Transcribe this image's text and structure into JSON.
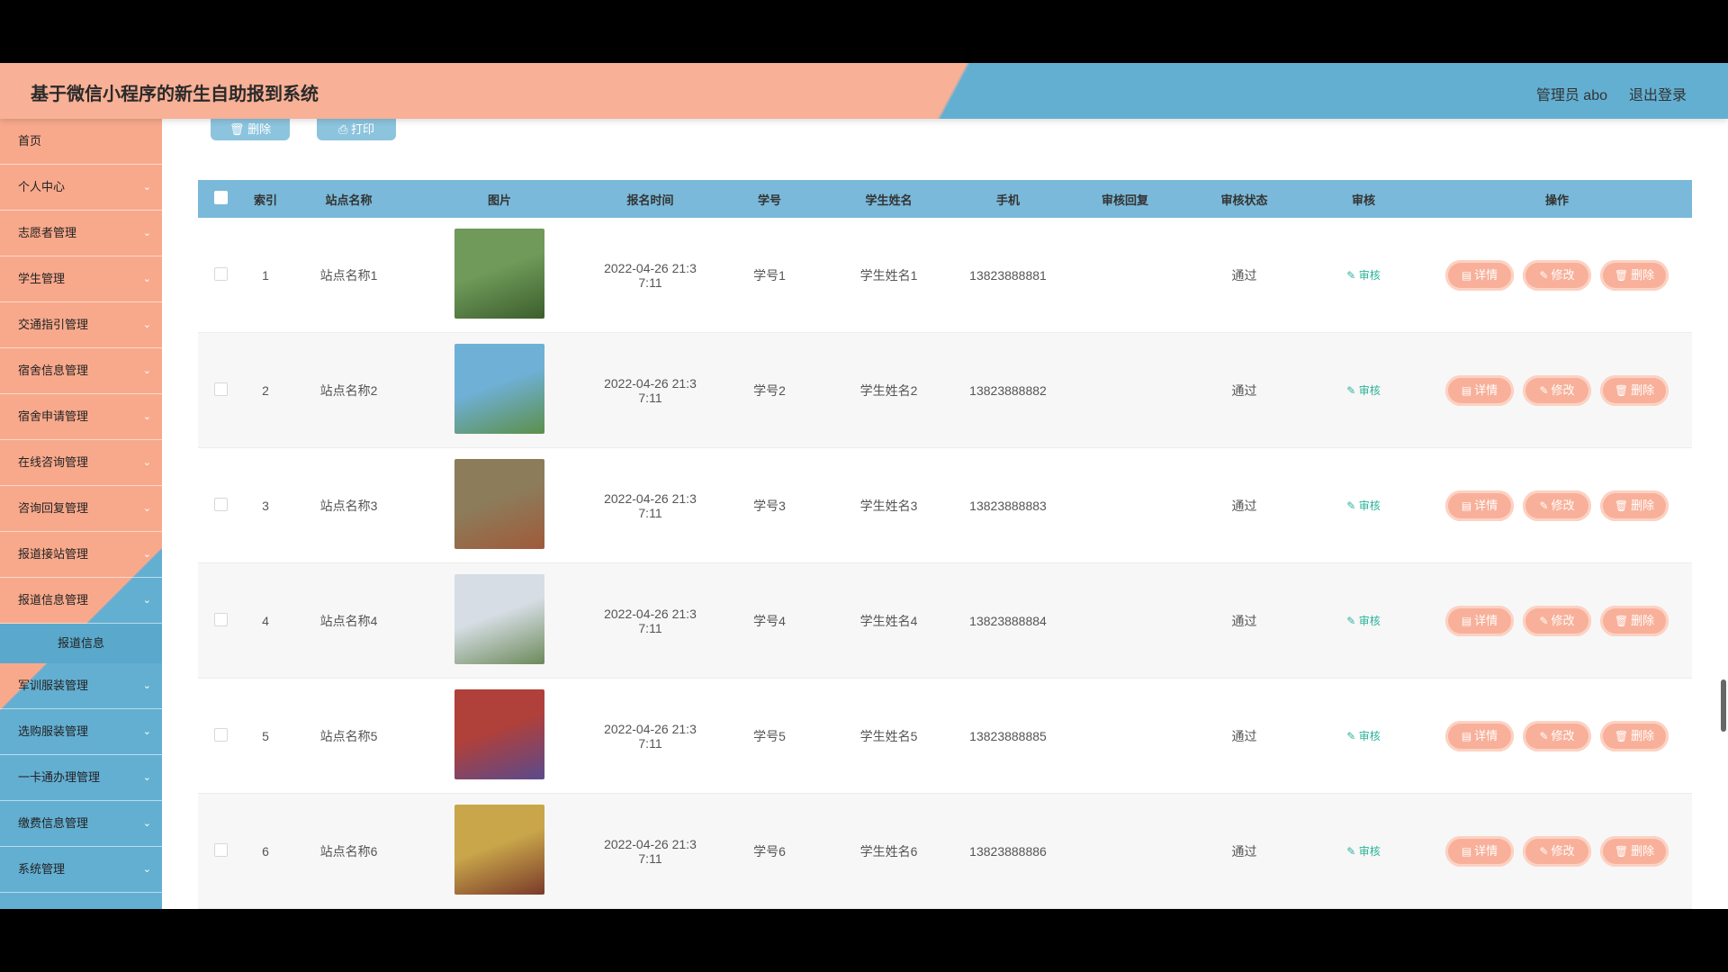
{
  "app": {
    "title": "基于微信小程序的新生自助报到系统"
  },
  "header": {
    "admin_label": "管理员 abo",
    "logout_label": "退出登录"
  },
  "sidebar": {
    "items": [
      {
        "label": "首页",
        "chevron": false
      },
      {
        "label": "个人中心",
        "chevron": true
      },
      {
        "label": "志愿者管理",
        "chevron": true
      },
      {
        "label": "学生管理",
        "chevron": true
      },
      {
        "label": "交通指引管理",
        "chevron": true
      },
      {
        "label": "宿舍信息管理",
        "chevron": true
      },
      {
        "label": "宿舍申请管理",
        "chevron": true
      },
      {
        "label": "在线咨询管理",
        "chevron": true
      },
      {
        "label": "咨询回复管理",
        "chevron": true
      },
      {
        "label": "报道接站管理",
        "chevron": true
      },
      {
        "label": "报道信息管理",
        "chevron": true
      }
    ],
    "active_sub": "报道信息",
    "items_after": [
      {
        "label": "军训服装管理",
        "chevron": true
      },
      {
        "label": "选购服装管理",
        "chevron": true
      },
      {
        "label": "一卡通办理管理",
        "chevron": true
      },
      {
        "label": "缴费信息管理",
        "chevron": true
      },
      {
        "label": "系统管理",
        "chevron": true
      }
    ]
  },
  "toolbar": {
    "delete_label": "删除",
    "print_label": "打印"
  },
  "table": {
    "headers": [
      "索引",
      "站点名称",
      "图片",
      "报名时间",
      "学号",
      "学生姓名",
      "手机",
      "审核回复",
      "审核状态",
      "审核",
      "操作"
    ],
    "rows": [
      {
        "index": "1",
        "site": "站点名称1",
        "time_line1": "2022-04-26 21:3",
        "time_line2": "7:11",
        "sno": "学号1",
        "name": "学生姓名1",
        "phone": "13823888881",
        "reply": "",
        "status": "通过",
        "image_colors": [
          "#6f9a5a",
          "#3c5e2c"
        ]
      },
      {
        "index": "2",
        "site": "站点名称2",
        "time_line1": "2022-04-26 21:3",
        "time_line2": "7:11",
        "sno": "学号2",
        "name": "学生姓名2",
        "phone": "13823888882",
        "reply": "",
        "status": "通过",
        "image_colors": [
          "#6fb0d6",
          "#5c8f4a"
        ]
      },
      {
        "index": "3",
        "site": "站点名称3",
        "time_line1": "2022-04-26 21:3",
        "time_line2": "7:11",
        "sno": "学号3",
        "name": "学生姓名3",
        "phone": "13823888883",
        "reply": "",
        "status": "通过",
        "image_colors": [
          "#8c7c5a",
          "#a05a3a"
        ]
      },
      {
        "index": "4",
        "site": "站点名称4",
        "time_line1": "2022-04-26 21:3",
        "time_line2": "7:11",
        "sno": "学号4",
        "name": "学生姓名4",
        "phone": "13823888884",
        "reply": "",
        "status": "通过",
        "image_colors": [
          "#d6dde4",
          "#6c8a5a"
        ]
      },
      {
        "index": "5",
        "site": "站点名称5",
        "time_line1": "2022-04-26 21:3",
        "time_line2": "7:11",
        "sno": "学号5",
        "name": "学生姓名5",
        "phone": "13823888885",
        "reply": "",
        "status": "通过",
        "image_colors": [
          "#b0403a",
          "#5a4a8c"
        ]
      },
      {
        "index": "6",
        "site": "站点名称6",
        "time_line1": "2022-04-26 21:3",
        "time_line2": "7:11",
        "sno": "学号6",
        "name": "学生姓名6",
        "phone": "13823888886",
        "reply": "",
        "status": "通过",
        "image_colors": [
          "#c9a64a",
          "#7a3a2a"
        ]
      }
    ],
    "audit_label": "审核",
    "op_labels": {
      "detail": "详情",
      "edit": "修改",
      "delete": "删除"
    }
  },
  "icons": {
    "delete": "trash-icon",
    "print": "printer-icon",
    "detail": "document-icon",
    "edit": "pencil-icon",
    "chevron": "chevron-down-icon"
  },
  "colors": {
    "header_peach": "#f8b096",
    "header_blue": "#63afd2",
    "op_button": "#f8b09a",
    "audit_green": "#2ab39a"
  }
}
